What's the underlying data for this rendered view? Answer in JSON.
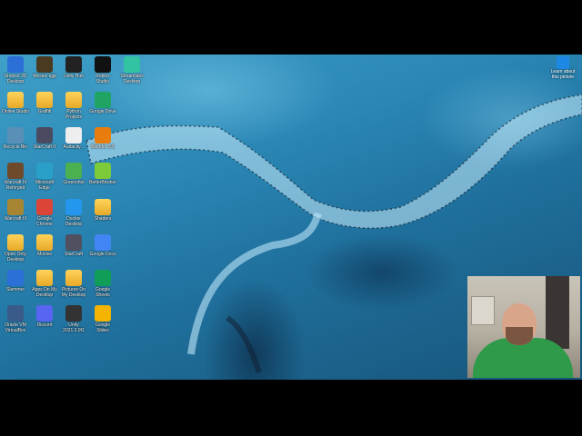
{
  "desktop_icons": [
    {
      "label": "Shotcut 3D\nDesktop",
      "icon": "shotcut-icon",
      "color": "#2c6fd6"
    },
    {
      "label": "Mosaic-iggi",
      "icon": "game-icon",
      "color": "#4a3b20"
    },
    {
      "label": "Unity Hub",
      "icon": "unity-icon",
      "color": "#222222"
    },
    {
      "label": "Roblox\nStudio",
      "icon": "roblox-icon",
      "color": "#111111"
    },
    {
      "label": "Streamlabs\nDesktop",
      "icon": "streamlabs-icon",
      "color": "#31c3a2"
    },
    {
      "label": "Online Studio",
      "icon": "folder-icon",
      "color": "#f0b93a"
    },
    {
      "label": "Graffiti",
      "icon": "folder-icon",
      "color": "#f0b93a"
    },
    {
      "label": "Python\nProjects",
      "icon": "folder-icon",
      "color": "#f0b93a"
    },
    {
      "label": "Google Drive",
      "icon": "google-drive-icon",
      "color": "#1fa463"
    },
    {
      "label": "Recycle Bin",
      "icon": "recycle-bin-icon",
      "color": "#5a8fb8"
    },
    {
      "label": "StarCraft II",
      "icon": "starcraft-icon",
      "color": "#4a4a60"
    },
    {
      "label": "Audacity...",
      "icon": "document-icon",
      "color": "#eeeeee"
    },
    {
      "label": "Blender 3.0",
      "icon": "blender-icon",
      "color": "#e87d0d"
    },
    {
      "label": "Warcraft III\nReforged",
      "icon": "warcraft-icon",
      "color": "#6e4a2a"
    },
    {
      "label": "Microsoft\nEdge",
      "icon": "edge-icon",
      "color": "#2aa0c8"
    },
    {
      "label": "Greenshot",
      "icon": "greenshot-icon",
      "color": "#4caf50"
    },
    {
      "label": "BetterBlocker",
      "icon": "cube-icon",
      "color": "#7ecb3a"
    },
    {
      "label": "Warcraft III",
      "icon": "warcraft-icon",
      "color": "#a88532"
    },
    {
      "label": "Google\nChrome",
      "icon": "chrome-icon",
      "color": "#db4437"
    },
    {
      "label": "Docker\nDesktop",
      "icon": "docker-icon",
      "color": "#2496ed"
    },
    {
      "label": "Shaders",
      "icon": "folder-icon",
      "color": "#f0b93a"
    },
    {
      "label": "Open Only\nDesktop",
      "icon": "folder-icon",
      "color": "#f0b93a"
    },
    {
      "label": "Movies",
      "icon": "folder-icon",
      "color": "#f0b93a"
    },
    {
      "label": "StarCraft",
      "icon": "starcraft-icon",
      "color": "#505060"
    },
    {
      "label": "Google Docs",
      "icon": "google-docs-icon",
      "color": "#4285f4"
    },
    {
      "label": "Slammer",
      "icon": "slammer-icon",
      "color": "#2c6fd6"
    },
    {
      "label": "Apps On My\nDesktop",
      "icon": "folder-icon",
      "color": "#f0b93a"
    },
    {
      "label": "Pictures On\nMy Desktop",
      "icon": "folder-icon",
      "color": "#f0b93a"
    },
    {
      "label": "Google\nSheets",
      "icon": "google-sheets-icon",
      "color": "#0f9d58"
    },
    {
      "label": "Oracle VM\nVirtualBox",
      "icon": "virtualbox-icon",
      "color": "#3a5a8a"
    },
    {
      "label": "Discord",
      "icon": "discord-icon",
      "color": "#5865f2"
    },
    {
      "label": "Unity\n2021.3.9f1",
      "icon": "unity-icon",
      "color": "#333333"
    },
    {
      "label": "Google\nSlides",
      "icon": "google-slides-icon",
      "color": "#f4b400"
    }
  ],
  "learn_icon": {
    "label": "Learn about\nthis picture",
    "icon": "learn-picture-icon",
    "color": "#1e88e5"
  },
  "webcam": {
    "label": "",
    "icon": "webcam-overlay",
    "color": "#2e9a4a"
  }
}
